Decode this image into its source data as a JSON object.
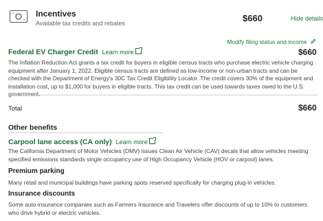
{
  "header": {
    "title": "Incentives",
    "subtitle": "Available tax credits and rebates",
    "amount": "$660",
    "hide_details": "Hide details"
  },
  "modify_link": "Modify filing status and income",
  "federal": {
    "title": "Federal EV Charger Credit",
    "learn_more": "Learn more",
    "amount": "$660",
    "description": "The Inflation Reduction Act grants a tax credit for buyers in eligible census tracts who purchase electric vehicle charging equipment after January 1, 2022. Eligible census tracts are defined as low-income or non-urban tracts and can be checked with the Department of Energy's 30C Tax Credit Eligibility Locator. The credit covers 30% of the equipment and installation cost, up to $1,000 for buyers in eligible tracts. This tax credit can be used towards taxes owed to the U.S. government."
  },
  "total": {
    "label": "Total",
    "amount": "$660"
  },
  "other_benefits": {
    "heading": "Other benefits",
    "carpool": {
      "title": "Carpool lane access (CA only)",
      "learn_more": "Learn more",
      "description": "The California Department of Motor Vehicles (DMV) issues Clean Air Vehicle (CAV) decals that allow vehicles meeting specified emissions standards single occupancy use of High Occupancy Vehicle (HOV or carpool) lanes."
    },
    "parking": {
      "title": "Premium parking",
      "description": "Many retail and municipal buildings have parking spots reserved specifically for charging plug-in vehicles."
    },
    "insurance": {
      "title": "Insurance discounts",
      "description": "Some auto insurance companies such as Farmers Insurance and Travelers offer discounts of up to 10% to customers who drive hybrid or electric vehicles."
    }
  },
  "colors": {
    "accent": "#1a6b35",
    "text": "#333333"
  },
  "icons": [
    "money-icon",
    "chevron-up-icon",
    "pencil-icon",
    "external-link-icon"
  ]
}
